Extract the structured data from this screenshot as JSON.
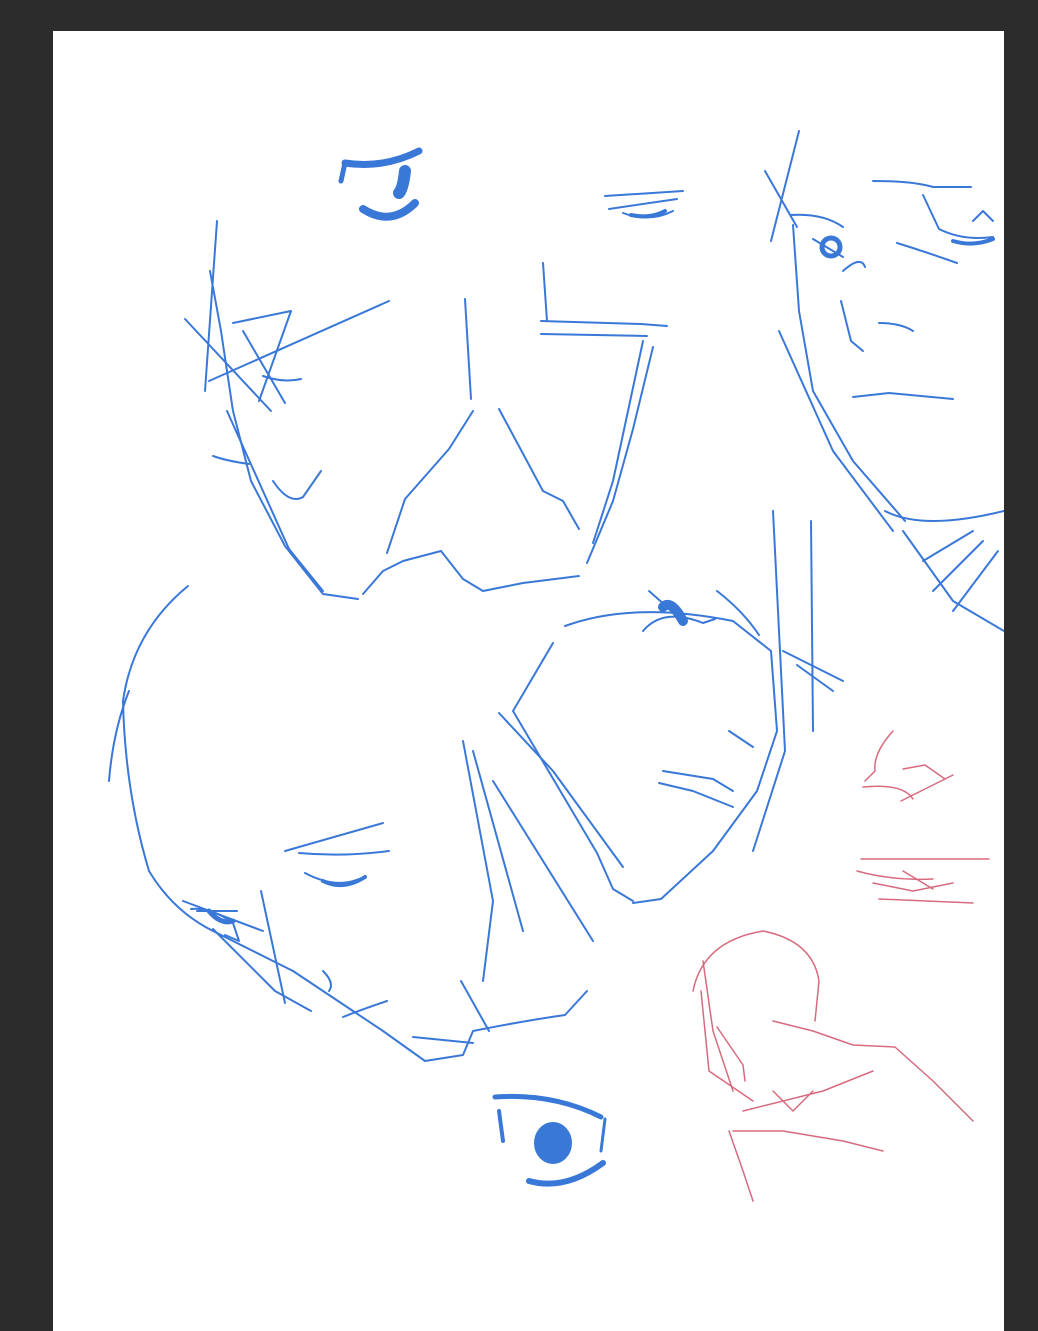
{
  "canvas": {
    "background": "#ffffff",
    "workspace_color": "#2c2c2c"
  },
  "strokes": {
    "blue": "#3a78d8",
    "red": "#d86a7e"
  },
  "sketches": [
    {
      "name": "floating-eye-top"
    },
    {
      "name": "head-upper-left"
    },
    {
      "name": "head-upper-middle"
    },
    {
      "name": "head-upper-right"
    },
    {
      "name": "head-lower-left"
    },
    {
      "name": "head-lower-middle"
    },
    {
      "name": "floating-eye-bottom"
    },
    {
      "name": "red-nose-study"
    },
    {
      "name": "red-mouth-study"
    },
    {
      "name": "red-figure-study"
    }
  ]
}
